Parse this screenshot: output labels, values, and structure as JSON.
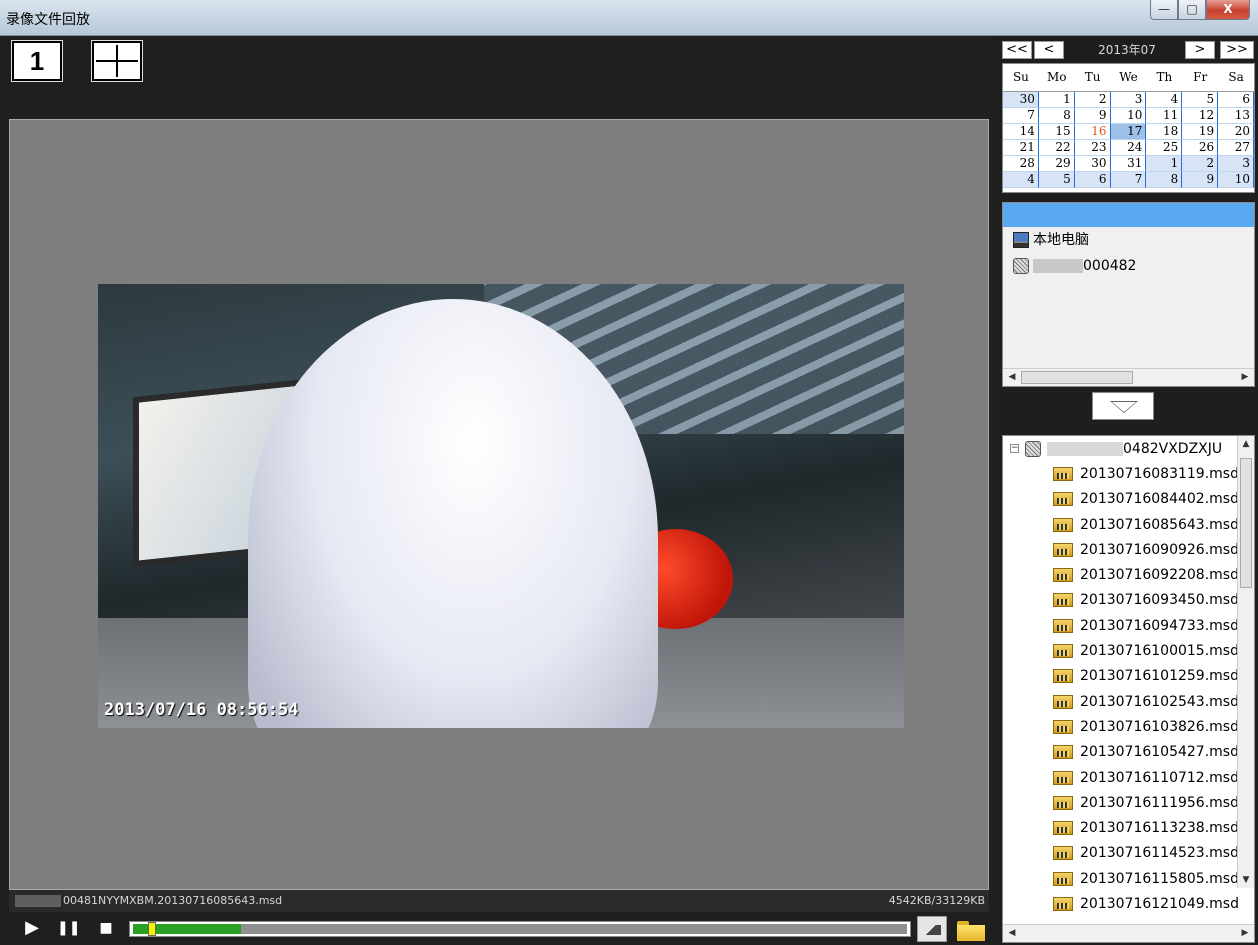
{
  "window": {
    "title": "录像文件回放",
    "minimize": "—",
    "maximize": "□",
    "close": "X"
  },
  "layout_buttons": {
    "single": "1"
  },
  "video": {
    "timestamp": "2013/07/16 08:56:54"
  },
  "status": {
    "filename": "00481NYYMXBM.20130716085643.msd",
    "size": "4542KB/33129KB"
  },
  "controls": {
    "play": "▶",
    "pause": "❚❚",
    "stop": "■",
    "progress": 0.14,
    "position": 0.02
  },
  "calendar": {
    "prev_year": "<<",
    "prev_month": "<",
    "month_label": "2013年07",
    "next_month": ">",
    "next_year": ">>",
    "weekdays": [
      "Su",
      "Mo",
      "Tu",
      "We",
      "Th",
      "Fr",
      "Sa"
    ],
    "days": [
      "30",
      "1",
      "2",
      "3",
      "4",
      "5",
      "6",
      "7",
      "8",
      "9",
      "10",
      "11",
      "12",
      "13",
      "14",
      "15",
      "16",
      "17",
      "18",
      "19",
      "20",
      "21",
      "22",
      "23",
      "24",
      "25",
      "26",
      "27",
      "28",
      "29",
      "30",
      "31",
      "1",
      "2",
      "3",
      "4",
      "5",
      "6",
      "7",
      "8",
      "9",
      "10"
    ],
    "today": "16",
    "selected": "17"
  },
  "device_tree": {
    "local": "本地电脑",
    "device": "000482"
  },
  "file_tree": {
    "root": "0482VXDZXJU",
    "files": [
      "20130716083119.msd",
      "20130716084402.msd",
      "20130716085643.msd",
      "20130716090926.msd",
      "20130716092208.msd",
      "20130716093450.msd",
      "20130716094733.msd",
      "20130716100015.msd",
      "20130716101259.msd",
      "20130716102543.msd",
      "20130716103826.msd",
      "20130716105427.msd",
      "20130716110712.msd",
      "20130716111956.msd",
      "20130716113238.msd",
      "20130716114523.msd",
      "20130716115805.msd",
      "20130716121049.msd"
    ]
  }
}
